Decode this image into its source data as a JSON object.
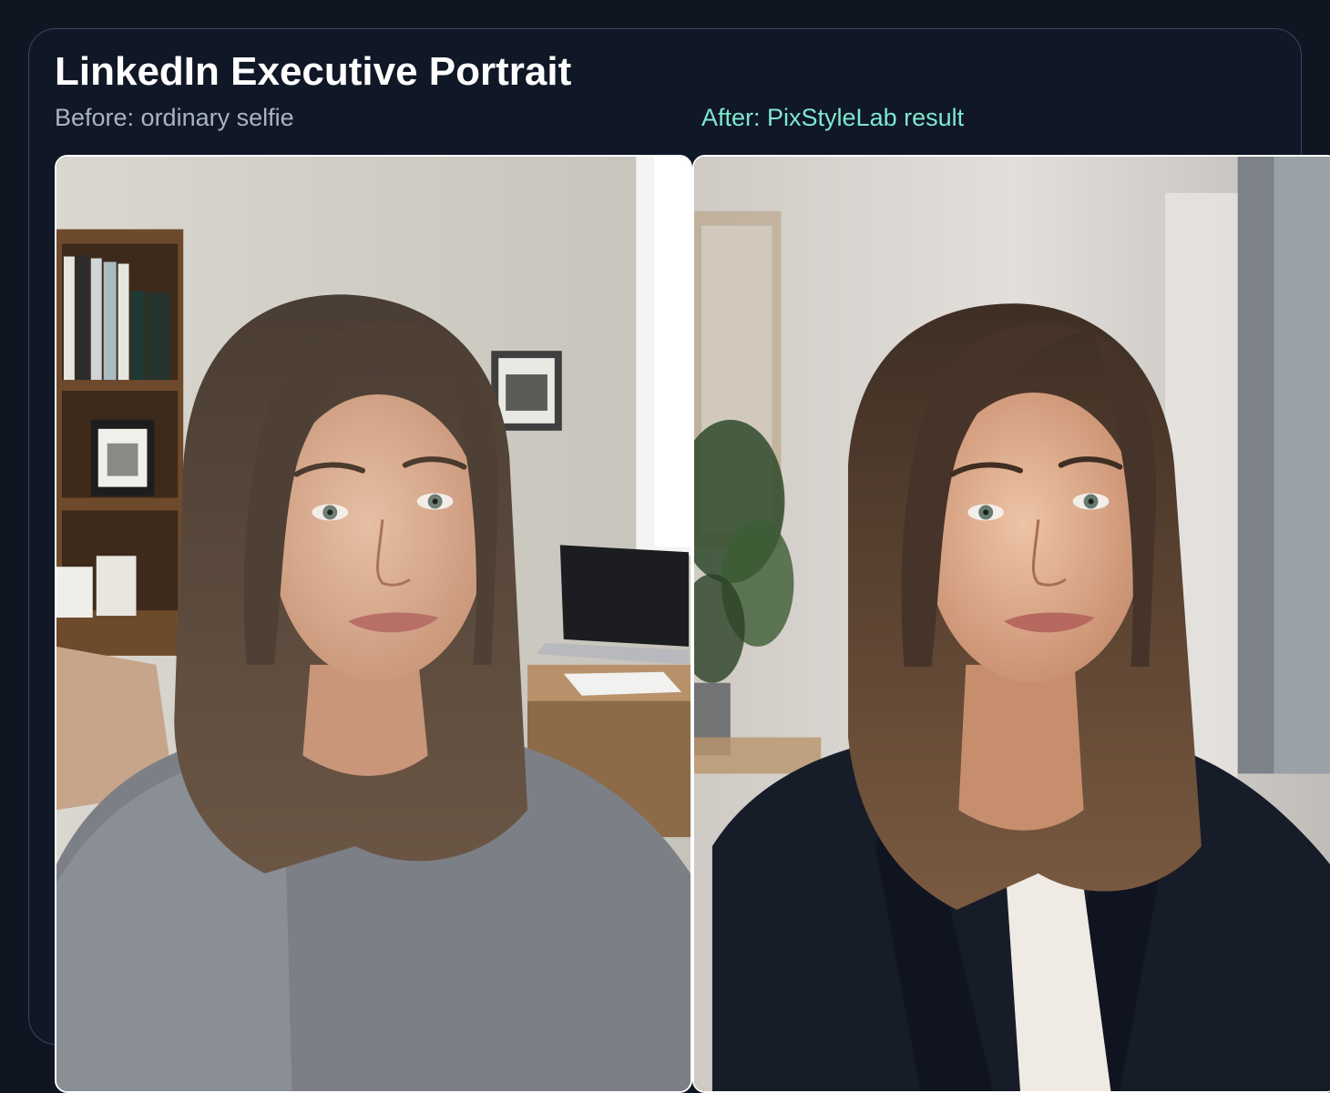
{
  "card": {
    "title": "LinkedIn Executive Portrait",
    "before_label": "Before: ordinary selfie",
    "after_label": "After: PixStyleLab result"
  },
  "images": {
    "before": "casual selfie of a woman with long brown hair in a grey sweater, home office with bookshelf and laptop behind",
    "after": "professional portrait of the same woman in a navy blazer and white top, soft-focus office background with plant"
  },
  "colors": {
    "page_bg": "#0f1521",
    "card_bg": "#101726",
    "card_border": "#3a4560",
    "title": "#ffffff",
    "before_label": "#aab3c3",
    "after_label": "#7ee8cf"
  }
}
